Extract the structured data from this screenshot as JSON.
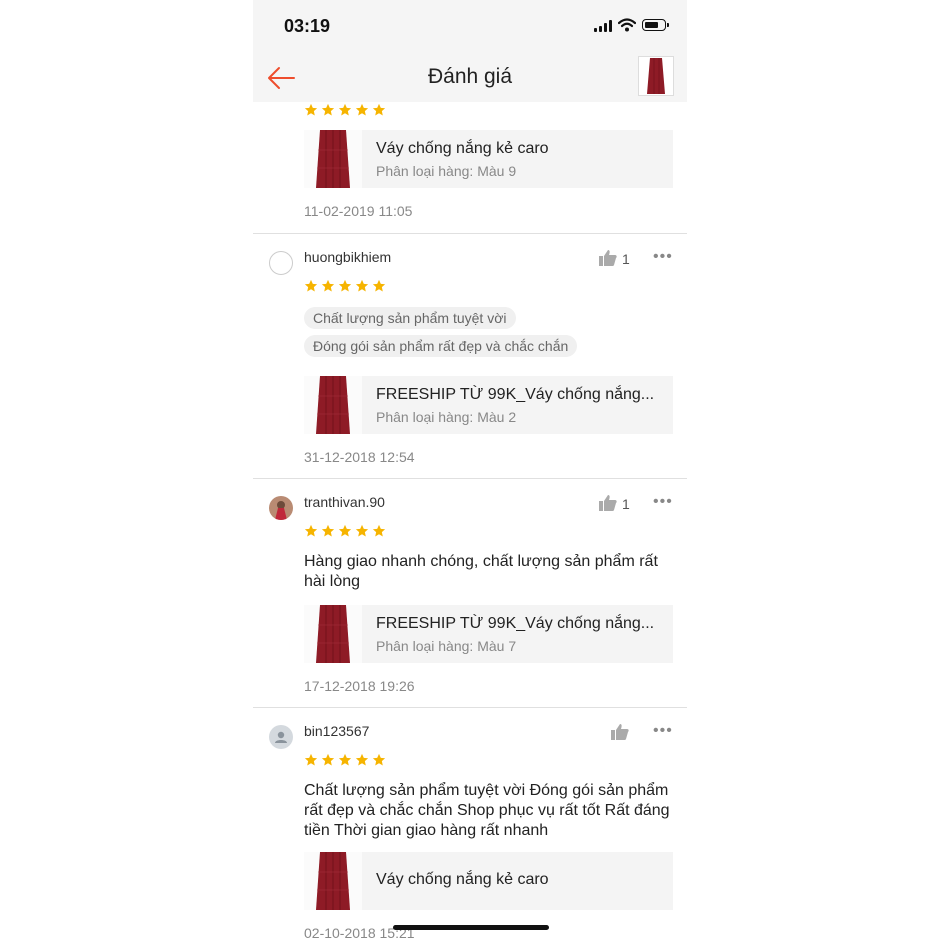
{
  "status": {
    "time": "03:19"
  },
  "nav": {
    "title": "Đánh giá"
  },
  "reviews": [
    {
      "rating": 5,
      "product": {
        "title": "Váy chống nắng kẻ caro",
        "variant": "Phân loại hàng: Màu 9"
      },
      "date": "11-02-2019 11:05"
    },
    {
      "username": "huongbikhiem",
      "likes": "1",
      "rating": 5,
      "tags": [
        "Chất lượng sản phẩm tuyệt vời",
        "Đóng gói sản phẩm rất đẹp và chắc chắn"
      ],
      "product": {
        "title": "FREESHIP TỪ 99K_Váy chống nắng...",
        "variant": "Phân loại hàng: Màu 2"
      },
      "date": "31-12-2018 12:54"
    },
    {
      "username": "tranthivan.90",
      "likes": "1",
      "rating": 5,
      "comment": "Hàng giao nhanh chóng, chất lượng sản phẩm rất hài lòng",
      "product": {
        "title": "FREESHIP TỪ 99K_Váy chống nắng...",
        "variant": "Phân loại hàng: Màu 7"
      },
      "date": "17-12-2018 19:26"
    },
    {
      "username": "bin123567",
      "rating": 5,
      "comment": " Chất lượng sản phẩm tuyệt vời Đóng gói sản phẩm rất đẹp và chắc chắn Shop phục vụ rất tốt Rất đáng tiền Thời gian giao hàng rất nhanh",
      "product": {
        "title": "Váy chống nắng kẻ caro"
      },
      "date": "02-10-2018 15:21"
    }
  ],
  "colors": {
    "accent": "#ee4d2d",
    "star": "#f6b400",
    "skirt": "#8e1b26"
  },
  "icons": [
    "back-arrow-icon",
    "thumbs-up-icon",
    "more-dots-icon",
    "star-icon",
    "signal-icon",
    "wifi-icon",
    "battery-icon"
  ],
  "battery_level": 0.7
}
